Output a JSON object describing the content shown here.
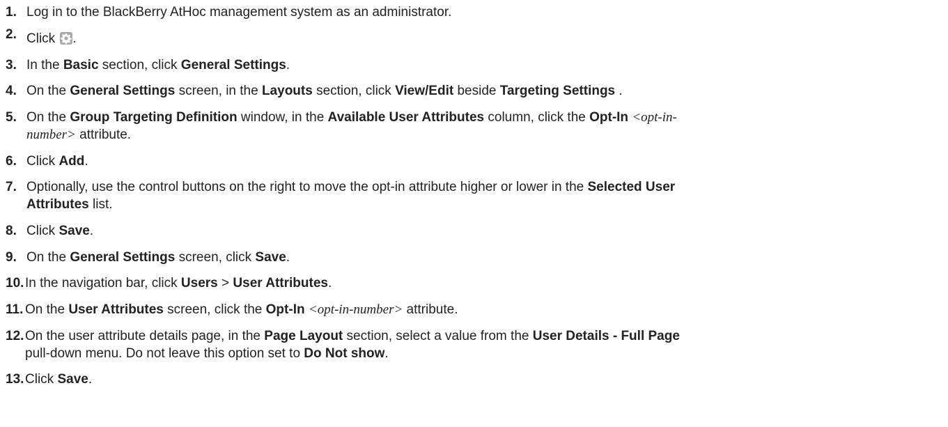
{
  "steps": [
    {
      "num": "1.",
      "parts": [
        {
          "t": "Log in to the BlackBerry AtHoc management system as an administrator."
        }
      ]
    },
    {
      "num": "2.",
      "parts": [
        {
          "t": "Click "
        },
        {
          "icon": "gear-icon"
        },
        {
          "t": "."
        }
      ]
    },
    {
      "num": "3.",
      "parts": [
        {
          "t": "In the "
        },
        {
          "b": "Basic"
        },
        {
          "t": " section, click "
        },
        {
          "b": "General Settings"
        },
        {
          "t": "."
        }
      ]
    },
    {
      "num": "4.",
      "parts": [
        {
          "t": "On the "
        },
        {
          "b": "General Settings"
        },
        {
          "t": " screen, in the "
        },
        {
          "b": "Layouts"
        },
        {
          "t": " section, click "
        },
        {
          "b": "View/Edit"
        },
        {
          "t": " beside "
        },
        {
          "b": "Targeting Settings"
        },
        {
          "t": " ."
        }
      ]
    },
    {
      "num": "5.",
      "parts": [
        {
          "t": "On the "
        },
        {
          "b": "Group Targeting Definition"
        },
        {
          "t": " window, in the "
        },
        {
          "b": "Available User Attributes"
        },
        {
          "t": " column, click the "
        },
        {
          "b": "Opt-In"
        },
        {
          "t": " "
        },
        {
          "i": "<opt-in-"
        },
        {
          "br": true
        },
        {
          "i": "number>"
        },
        {
          "t": " attribute."
        }
      ]
    },
    {
      "num": "6.",
      "parts": [
        {
          "t": "Click "
        },
        {
          "b": "Add"
        },
        {
          "t": "."
        }
      ]
    },
    {
      "num": "7.",
      "parts": [
        {
          "t": "Optionally, use the control buttons on the right to move the opt-in attribute higher or lower in the "
        },
        {
          "b": "Selected User"
        },
        {
          "br": true
        },
        {
          "b": "Attributes"
        },
        {
          "t": " list."
        }
      ]
    },
    {
      "num": "8.",
      "parts": [
        {
          "t": "Click "
        },
        {
          "b": "Save"
        },
        {
          "t": "."
        }
      ]
    },
    {
      "num": "9.",
      "parts": [
        {
          "t": "On the "
        },
        {
          "b": "General Settings"
        },
        {
          "t": " screen, click "
        },
        {
          "b": "Save"
        },
        {
          "t": "."
        }
      ]
    },
    {
      "num": "10.",
      "parts": [
        {
          "t": "In the navigation bar, click "
        },
        {
          "b": "Users"
        },
        {
          "t": " > "
        },
        {
          "b": "User Attributes"
        },
        {
          "t": "."
        }
      ]
    },
    {
      "num": "11.",
      "parts": [
        {
          "t": "On the "
        },
        {
          "b": "User Attributes"
        },
        {
          "t": " screen, click the "
        },
        {
          "b": "Opt-In"
        },
        {
          "t": " "
        },
        {
          "i": "<opt-in-number>"
        },
        {
          "t": " attribute."
        }
      ]
    },
    {
      "num": "12.",
      "parts": [
        {
          "t": "On the user attribute details page, in the "
        },
        {
          "b": "Page Layout"
        },
        {
          "t": " section, select a value from the "
        },
        {
          "b": "User Details - Full Page"
        },
        {
          "br": true
        },
        {
          "t": "pull-down menu. Do not leave this option set to "
        },
        {
          "b": "Do Not show"
        },
        {
          "t": "."
        }
      ]
    },
    {
      "num": "13.",
      "parts": [
        {
          "t": "Click "
        },
        {
          "b": "Save"
        },
        {
          "t": "."
        }
      ]
    }
  ]
}
